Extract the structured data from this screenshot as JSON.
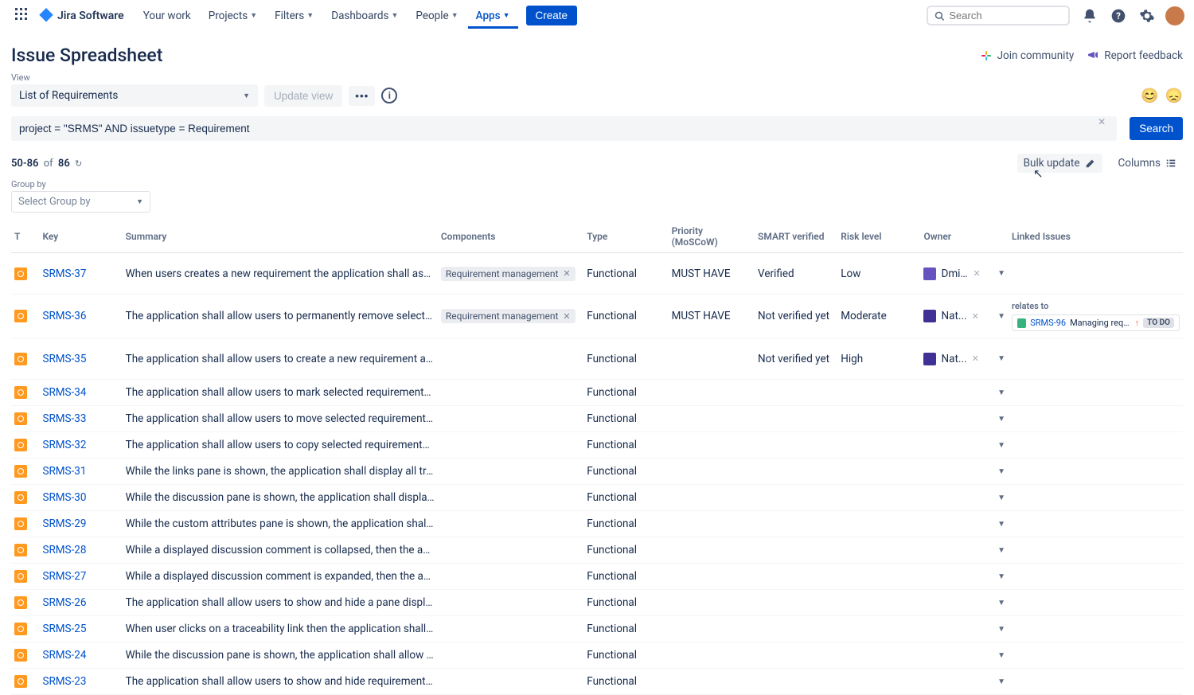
{
  "nav": {
    "logo": "Jira Software",
    "items": [
      "Your work",
      "Projects",
      "Filters",
      "Dashboards",
      "People",
      "Apps"
    ],
    "active_index": 5,
    "create": "Create",
    "search_placeholder": "Search"
  },
  "header": {
    "title": "Issue Spreadsheet",
    "join": "Join community",
    "report": "Report feedback"
  },
  "view": {
    "label": "View",
    "selected": "List of Requirements",
    "update": "Update view"
  },
  "jql": {
    "query": "project = \"SRMS\" AND issuetype = Requirement",
    "search": "Search"
  },
  "count": {
    "text_prefix": "50-86",
    "of": "of",
    "total": "86",
    "bulk": "Bulk update",
    "columns": "Columns"
  },
  "group": {
    "label": "Group by",
    "placeholder": "Select Group by"
  },
  "columns": [
    "T",
    "Key",
    "Summary",
    "Components",
    "Type",
    "Priority (MoSCoW)",
    "SMART verified",
    "Risk level",
    "Owner",
    "Linked Issues"
  ],
  "linked": {
    "relates": "relates to",
    "key": "SRMS-96",
    "summary": "Managing requ...",
    "status": "TO DO"
  },
  "rows": [
    {
      "key": "SRMS-37",
      "summary": "When users creates a new requirement the application shall assign it a unique I...",
      "comp": "Requirement management",
      "type": "Functional",
      "prio": "MUST HAVE",
      "smart": "Verified",
      "risk": "Low",
      "owner": "Dmi...",
      "avatar": "a"
    },
    {
      "key": "SRMS-36",
      "summary": "The application shall allow users to permanently remove selected deleted requi...",
      "comp": "Requirement management",
      "type": "Functional",
      "prio": "MUST HAVE",
      "smart": "Not verified yet",
      "risk": "Moderate",
      "owner": "Nat...",
      "avatar": "b",
      "linked": true
    },
    {
      "key": "SRMS-35",
      "summary": "The application shall allow users to create a new requirement and place it in an...",
      "type": "Functional",
      "smart": "Not verified yet",
      "risk": "High",
      "owner": "Nat...",
      "avatar": "b"
    },
    {
      "key": "SRMS-34",
      "summary": "The application shall allow users to mark selected requirements or document s...",
      "type": "Functional"
    },
    {
      "key": "SRMS-33",
      "summary": "The application shall allow users to move selected requirements or document s...",
      "type": "Functional"
    },
    {
      "key": "SRMS-32",
      "summary": "The application shall allow users to copy selected requirements or document se...",
      "type": "Functional"
    },
    {
      "key": "SRMS-31",
      "summary": "While the links pane is shown, the application shall display all traceability links s...",
      "type": "Functional"
    },
    {
      "key": "SRMS-30",
      "summary": "While the discussion pane is shown, the application shall display all comments f...",
      "type": "Functional"
    },
    {
      "key": "SRMS-29",
      "summary": "While the custom attributes pane is shown, the application shall display values ...",
      "type": "Functional"
    },
    {
      "key": "SRMS-28",
      "summary": "While a displayed discussion comment is collapsed, then the application shall d...",
      "type": "Functional"
    },
    {
      "key": "SRMS-27",
      "summary": "While a displayed discussion comment is expanded, then the application shall ...",
      "type": "Functional"
    },
    {
      "key": "SRMS-26",
      "summary": "The application shall allow users to show and hide a pane displaying detailed in...",
      "type": "Functional"
    },
    {
      "key": "SRMS-25",
      "summary": "When user clicks on a traceability link then the application shall focus the linke...",
      "type": "Functional"
    },
    {
      "key": "SRMS-24",
      "summary": "While the discussion pane is shown, the application shall allow users to expand...",
      "type": "Functional"
    },
    {
      "key": "SRMS-23",
      "summary": "The application shall allow users to show and hide requirements table columns ...",
      "type": "Functional"
    }
  ]
}
